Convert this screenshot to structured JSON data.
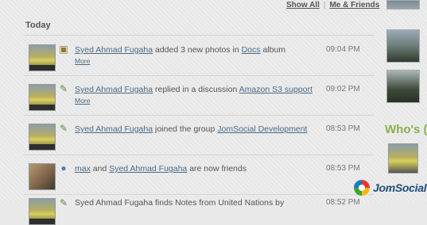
{
  "filters": {
    "show_all": "Show All",
    "me_and_friends": "Me & Friends"
  },
  "section": {
    "heading": "Today"
  },
  "feed": [
    {
      "actor": "Syed Ahmad Fugaha",
      "pre": "",
      "mid": " added 3 new photos in ",
      "target": "Docs",
      "post": " album",
      "more": "More",
      "time": "09:04 PM",
      "icon": "photo-icon"
    },
    {
      "actor": "Syed Ahmad Fugaha",
      "pre": "",
      "mid": " replied in a discussion ",
      "target": "Amazon S3 support",
      "post": "",
      "more": "More",
      "time": "09:02 PM",
      "icon": "discussion-icon"
    },
    {
      "actor": "Syed Ahmad Fugaha",
      "pre": "",
      "mid": " joined the group ",
      "target": "JomSocial Development",
      "post": "",
      "more": "",
      "time": "08:53 PM",
      "icon": "group-icon"
    },
    {
      "actor": "max",
      "pre": "",
      "mid": " and ",
      "target": "Syed Ahmad Fugaha",
      "post": " are now friends",
      "more": "",
      "time": "08:53 PM",
      "icon": "friends-icon"
    },
    {
      "actor": "",
      "pre": "Syed Ahmad Fugaha finds Notes from United Nations by",
      "mid": "",
      "target": "",
      "post": "",
      "more": "",
      "time": "08:52 PM",
      "icon": "note-icon"
    }
  ],
  "sidebar": {
    "heading": "Who's ("
  },
  "brand": {
    "name": "JomSocial"
  }
}
